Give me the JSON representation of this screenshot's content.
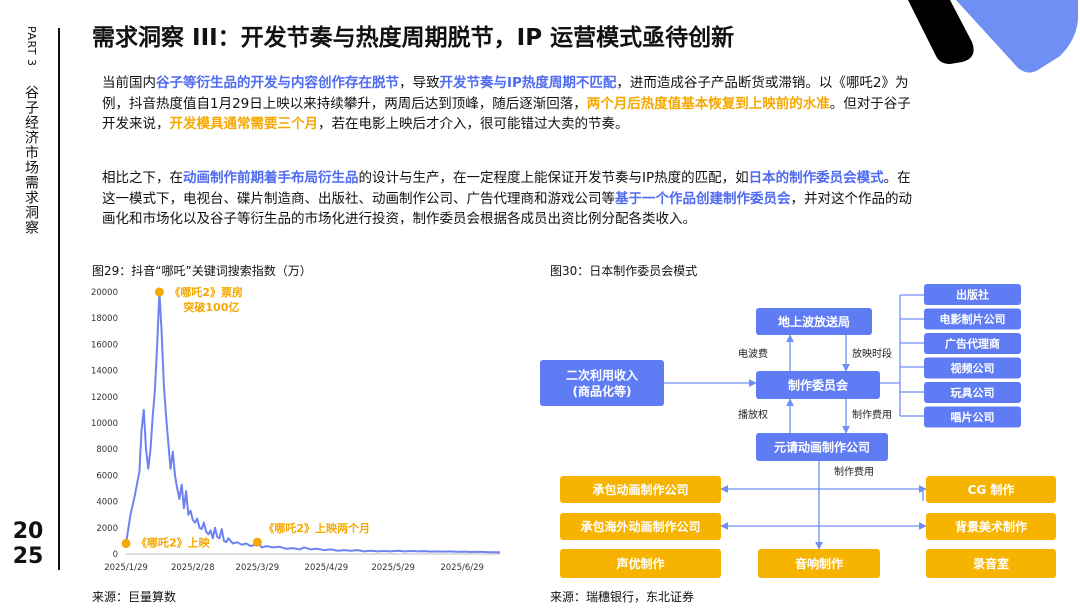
{
  "side": {
    "part": "PART 3",
    "section": "谷子经济市场需求洞察",
    "year_top": "20",
    "year_bottom": "25"
  },
  "title": "需求洞察 III：开发节奏与热度周期脱节，IP 运营模式亟待创新",
  "para1": [
    {
      "t": "当前国内",
      "s": ""
    },
    {
      "t": "谷子等衍生品的开发与内容创作存在脱节",
      "s": "blue"
    },
    {
      "t": "，导致",
      "s": ""
    },
    {
      "t": "开发节奏与IP热度周期不匹配",
      "s": "blue"
    },
    {
      "t": "，进而造成谷子产品断货或滞销。以《哪吒2》为例，抖音热度值自1月29日上映以来持续攀升，两周后达到顶峰，随后逐渐回落，",
      "s": ""
    },
    {
      "t": "两个月后热度值基本恢复到上映前的水准",
      "s": "orange"
    },
    {
      "t": "。但对于谷子开发来说，",
      "s": ""
    },
    {
      "t": "开发模具通常需要三个月",
      "s": "orange"
    },
    {
      "t": "，若在电影上映后才介入，很可能错过大卖的节奏。",
      "s": ""
    }
  ],
  "para2": [
    {
      "t": "相比之下，在",
      "s": ""
    },
    {
      "t": "动画制作前期着手布局衍生品",
      "s": "blue"
    },
    {
      "t": "的设计与生产，在一定程度上能保证开发节奏与IP热度的匹配，如",
      "s": ""
    },
    {
      "t": "日本的制作委员会模式",
      "s": "blue"
    },
    {
      "t": "。在这一模式下，电视台、碟片制造商、出版社、动画制作公司、广告代理商和游戏公司等",
      "s": ""
    },
    {
      "t": "基于一个作品创建制作委员会",
      "s": "blue"
    },
    {
      "t": "，并对这个作品的动画化和市场化以及谷子等衍生品的市场化进行投资，制作委员会根据各成员出资比例分配各类收入。",
      "s": ""
    }
  ],
  "fig29": {
    "caption": "图29：抖音“哪吒”关键词搜索指数（万）",
    "source": "来源：巨量算数"
  },
  "fig30": {
    "caption": "图30：日本制作委员会模式",
    "source": "来源：瑞穗银行，东北证券"
  },
  "chart_data": {
    "type": "line",
    "title": "",
    "xlabel": "",
    "ylabel": "",
    "ylim": [
      0,
      20000
    ],
    "y_ticks": [
      0,
      2000,
      4000,
      6000,
      8000,
      10000,
      12000,
      14000,
      16000,
      18000,
      20000
    ],
    "x_tick_labels": [
      "2025/1/29",
      "2025/2/28",
      "2025/3/29",
      "2025/4/29",
      "2025/5/29",
      "2025/6/29"
    ],
    "x_tick_days": [
      0,
      30,
      59,
      90,
      120,
      151
    ],
    "x_range_days": [
      0,
      168
    ],
    "series": [
      {
        "color": "#6f83f0",
        "points": [
          [
            0,
            800
          ],
          [
            2,
            3000
          ],
          [
            4,
            4500
          ],
          [
            6,
            6300
          ],
          [
            7,
            9500
          ],
          [
            8,
            11000
          ],
          [
            9,
            8000
          ],
          [
            10,
            6500
          ],
          [
            11,
            8000
          ],
          [
            12,
            10500
          ],
          [
            13,
            12500
          ],
          [
            14,
            16000
          ],
          [
            15,
            20000
          ],
          [
            16,
            17000
          ],
          [
            17,
            13000
          ],
          [
            18,
            10500
          ],
          [
            19,
            8500
          ],
          [
            20,
            6500
          ],
          [
            21,
            7800
          ],
          [
            22,
            6000
          ],
          [
            23,
            5000
          ],
          [
            24,
            4200
          ],
          [
            25,
            5300
          ],
          [
            26,
            3500
          ],
          [
            27,
            4800
          ],
          [
            28,
            3000
          ],
          [
            29,
            3300
          ],
          [
            30,
            2600
          ],
          [
            31,
            2400
          ],
          [
            32,
            2700
          ],
          [
            33,
            2000
          ],
          [
            34,
            1900
          ],
          [
            35,
            2400
          ],
          [
            36,
            1700
          ],
          [
            37,
            1500
          ],
          [
            38,
            1800
          ],
          [
            39,
            1200
          ],
          [
            40,
            2000
          ],
          [
            41,
            1300
          ],
          [
            42,
            1200
          ],
          [
            43,
            1900
          ],
          [
            44,
            1000
          ],
          [
            45,
            900
          ],
          [
            46,
            1200
          ],
          [
            48,
            800
          ],
          [
            50,
            900
          ],
          [
            52,
            700
          ],
          [
            54,
            800
          ],
          [
            56,
            600
          ],
          [
            58,
            700
          ],
          [
            59,
            900
          ],
          [
            61,
            500
          ],
          [
            63,
            600
          ],
          [
            66,
            500
          ],
          [
            69,
            550
          ],
          [
            72,
            400
          ],
          [
            75,
            450
          ],
          [
            78,
            350
          ],
          [
            80,
            500
          ],
          [
            83,
            350
          ],
          [
            86,
            400
          ],
          [
            89,
            300
          ],
          [
            92,
            350
          ],
          [
            95,
            250
          ],
          [
            98,
            300
          ],
          [
            101,
            250
          ],
          [
            104,
            300
          ],
          [
            107,
            200
          ],
          [
            110,
            250
          ],
          [
            113,
            200
          ],
          [
            116,
            230
          ],
          [
            119,
            200
          ],
          [
            122,
            250
          ],
          [
            125,
            200
          ],
          [
            128,
            230
          ],
          [
            131,
            200
          ],
          [
            134,
            220
          ],
          [
            137,
            180
          ],
          [
            140,
            200
          ],
          [
            143,
            180
          ],
          [
            146,
            200
          ],
          [
            149,
            160
          ],
          [
            152,
            180
          ],
          [
            155,
            150
          ],
          [
            158,
            170
          ],
          [
            161,
            150
          ],
          [
            164,
            140
          ],
          [
            168,
            130
          ]
        ]
      }
    ],
    "annotations": [
      {
        "x": 0,
        "y": 800,
        "text": "《哪吒2》上映",
        "color": "#f6a800"
      },
      {
        "x": 15,
        "y": 20000,
        "text": "《哪吒2》票房 突破100亿",
        "color": "#f6a800"
      },
      {
        "x": 59,
        "y": 900,
        "text": "《哪吒2》上映两个月",
        "color": "#f6a800"
      }
    ]
  },
  "diagram": {
    "nodes": {
      "broadcaster": "地上波放送局",
      "committee": "制作委员会",
      "secondary": "二次利用收入\n(商品化等)",
      "prime": "元请动画制作公司",
      "members": [
        "出版社",
        "电影制片公司",
        "广告代理商",
        "视频公司",
        "玩具公司",
        "唱片公司"
      ],
      "sub1": "承包动画制作公司",
      "sub2": "承包海外动画制作公司",
      "voice": "声优制作",
      "sound": "音响制作",
      "cg": "CG 制作",
      "bg": "背景美术制作",
      "studio": "录音室"
    },
    "edge_labels": {
      "radio_fee": "电波费",
      "air_slot": "放映时段",
      "broadcast_rights": "播放权",
      "prod_fee1": "制作费用",
      "prod_fee2": "制作费用"
    },
    "colors": {
      "blue": "#5f7cf5",
      "orange": "#f6b400",
      "line": "#6f8ff5"
    }
  },
  "deco": {
    "black": "#000000",
    "blue": "#6f8ff5"
  }
}
